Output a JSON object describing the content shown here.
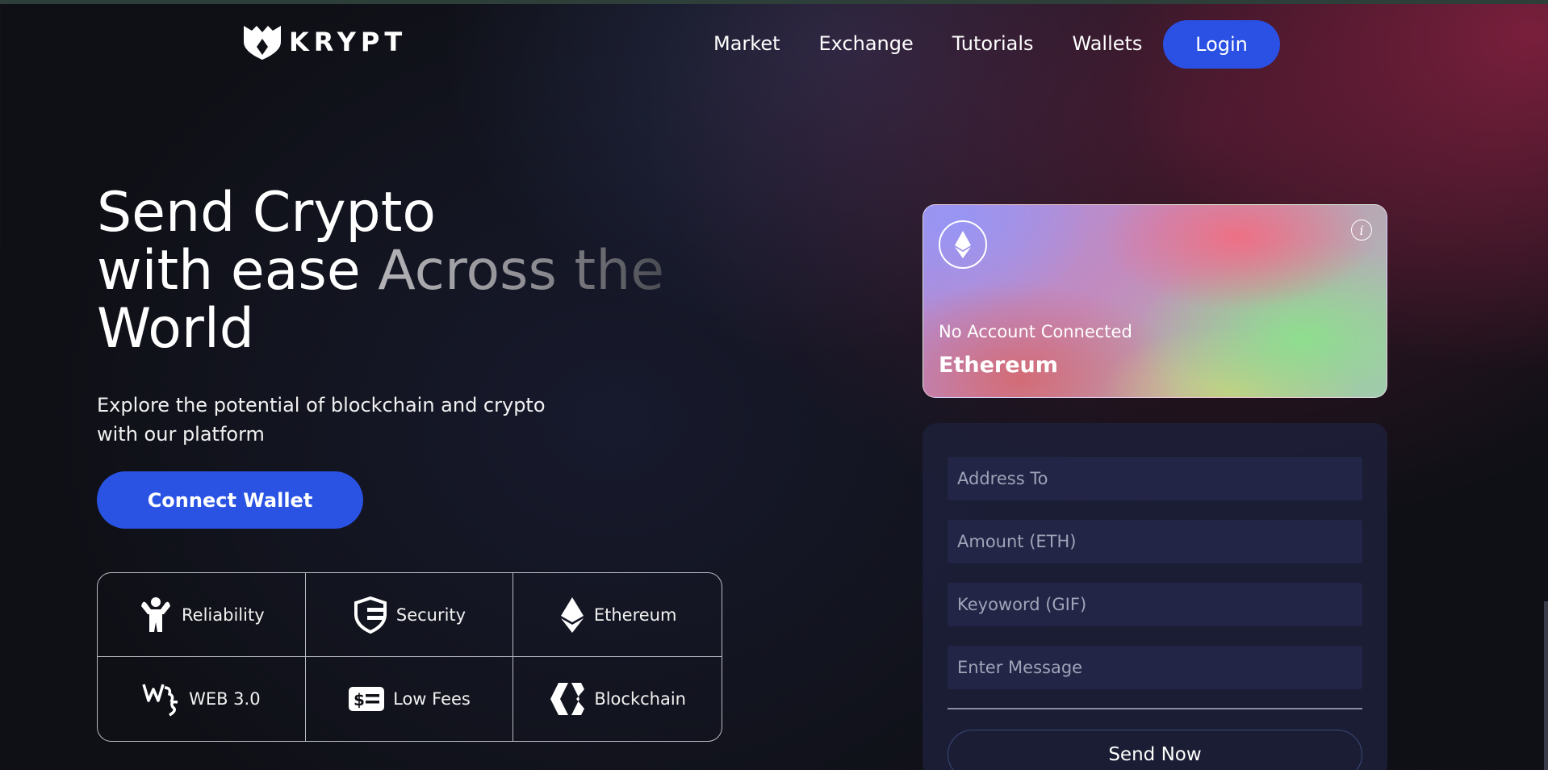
{
  "header": {
    "logo_text": "KRYPT",
    "nav": [
      "Market",
      "Exchange",
      "Tutorials",
      "Wallets"
    ],
    "login_label": "Login"
  },
  "hero": {
    "title_line1": "Send Crypto",
    "title_line2_a": "with ease ",
    "title_line2_b": "Across the",
    "title_line3": "World",
    "subtitle": "Explore the potential of blockchain and crypto with our platform",
    "connect_label": "Connect Wallet"
  },
  "features": [
    {
      "label": "Reliability",
      "icon": "strongman-icon"
    },
    {
      "label": "Security",
      "icon": "shield-icon"
    },
    {
      "label": "Ethereum",
      "icon": "ethereum-icon"
    },
    {
      "label": "WEB 3.0",
      "icon": "web3-icon"
    },
    {
      "label": "Low Fees",
      "icon": "dollar-bill-icon"
    },
    {
      "label": "Blockchain",
      "icon": "blockchain-icon"
    }
  ],
  "card": {
    "status": "No Account Connected",
    "coin": "Ethereum"
  },
  "form": {
    "address_placeholder": "Address To",
    "amount_placeholder": "Amount (ETH)",
    "keyword_placeholder": "Keyoword (GIF)",
    "message_placeholder": "Enter Message",
    "send_label": "Send Now"
  },
  "colors": {
    "accent_blue": "#2a50e4",
    "background": "#0f1016",
    "panel": "#1e203c",
    "input": "#222545"
  }
}
